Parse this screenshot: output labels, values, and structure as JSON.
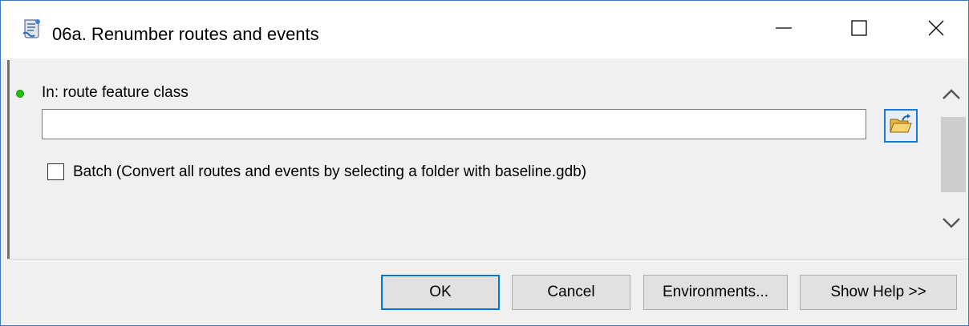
{
  "window": {
    "title": "06a. Renumber routes and events",
    "icon": "script-tool-icon",
    "controls": [
      "minimize-icon",
      "maximize-icon",
      "close-icon"
    ]
  },
  "parameter": {
    "label": "In: route feature class",
    "value": "",
    "status_color": "#21c20e",
    "browse_icon": "open-folder-icon"
  },
  "batch": {
    "label": "Batch (Convert all routes and events by selecting a folder with baseline.gdb)",
    "checked": false
  },
  "buttons": {
    "ok": "OK",
    "cancel": "Cancel",
    "environments": "Environments...",
    "show_help": "Show Help >>"
  },
  "colors": {
    "accent": "#0078d7",
    "background": "#f0f0f0"
  }
}
